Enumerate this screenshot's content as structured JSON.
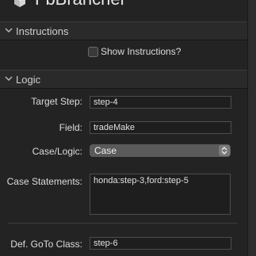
{
  "window": {
    "title": "FbBrancher"
  },
  "sections": {
    "instructions": {
      "label": "Instructions"
    },
    "logic": {
      "label": "Logic"
    }
  },
  "show_instructions": {
    "label": "Show Instructions?",
    "checked": false
  },
  "fields": {
    "target_step": {
      "label": "Target Step:",
      "value": "step-4"
    },
    "field": {
      "label": "Field:",
      "value": "tradeMake"
    },
    "case_logic": {
      "label": "Case/Logic:",
      "value": "Case"
    },
    "case_statements": {
      "label": "Case Statements:",
      "value": "honda:step-3,ford:step-5"
    },
    "def_goto_class": {
      "label": "Def. GoTo Class:",
      "value": "step-6"
    }
  }
}
